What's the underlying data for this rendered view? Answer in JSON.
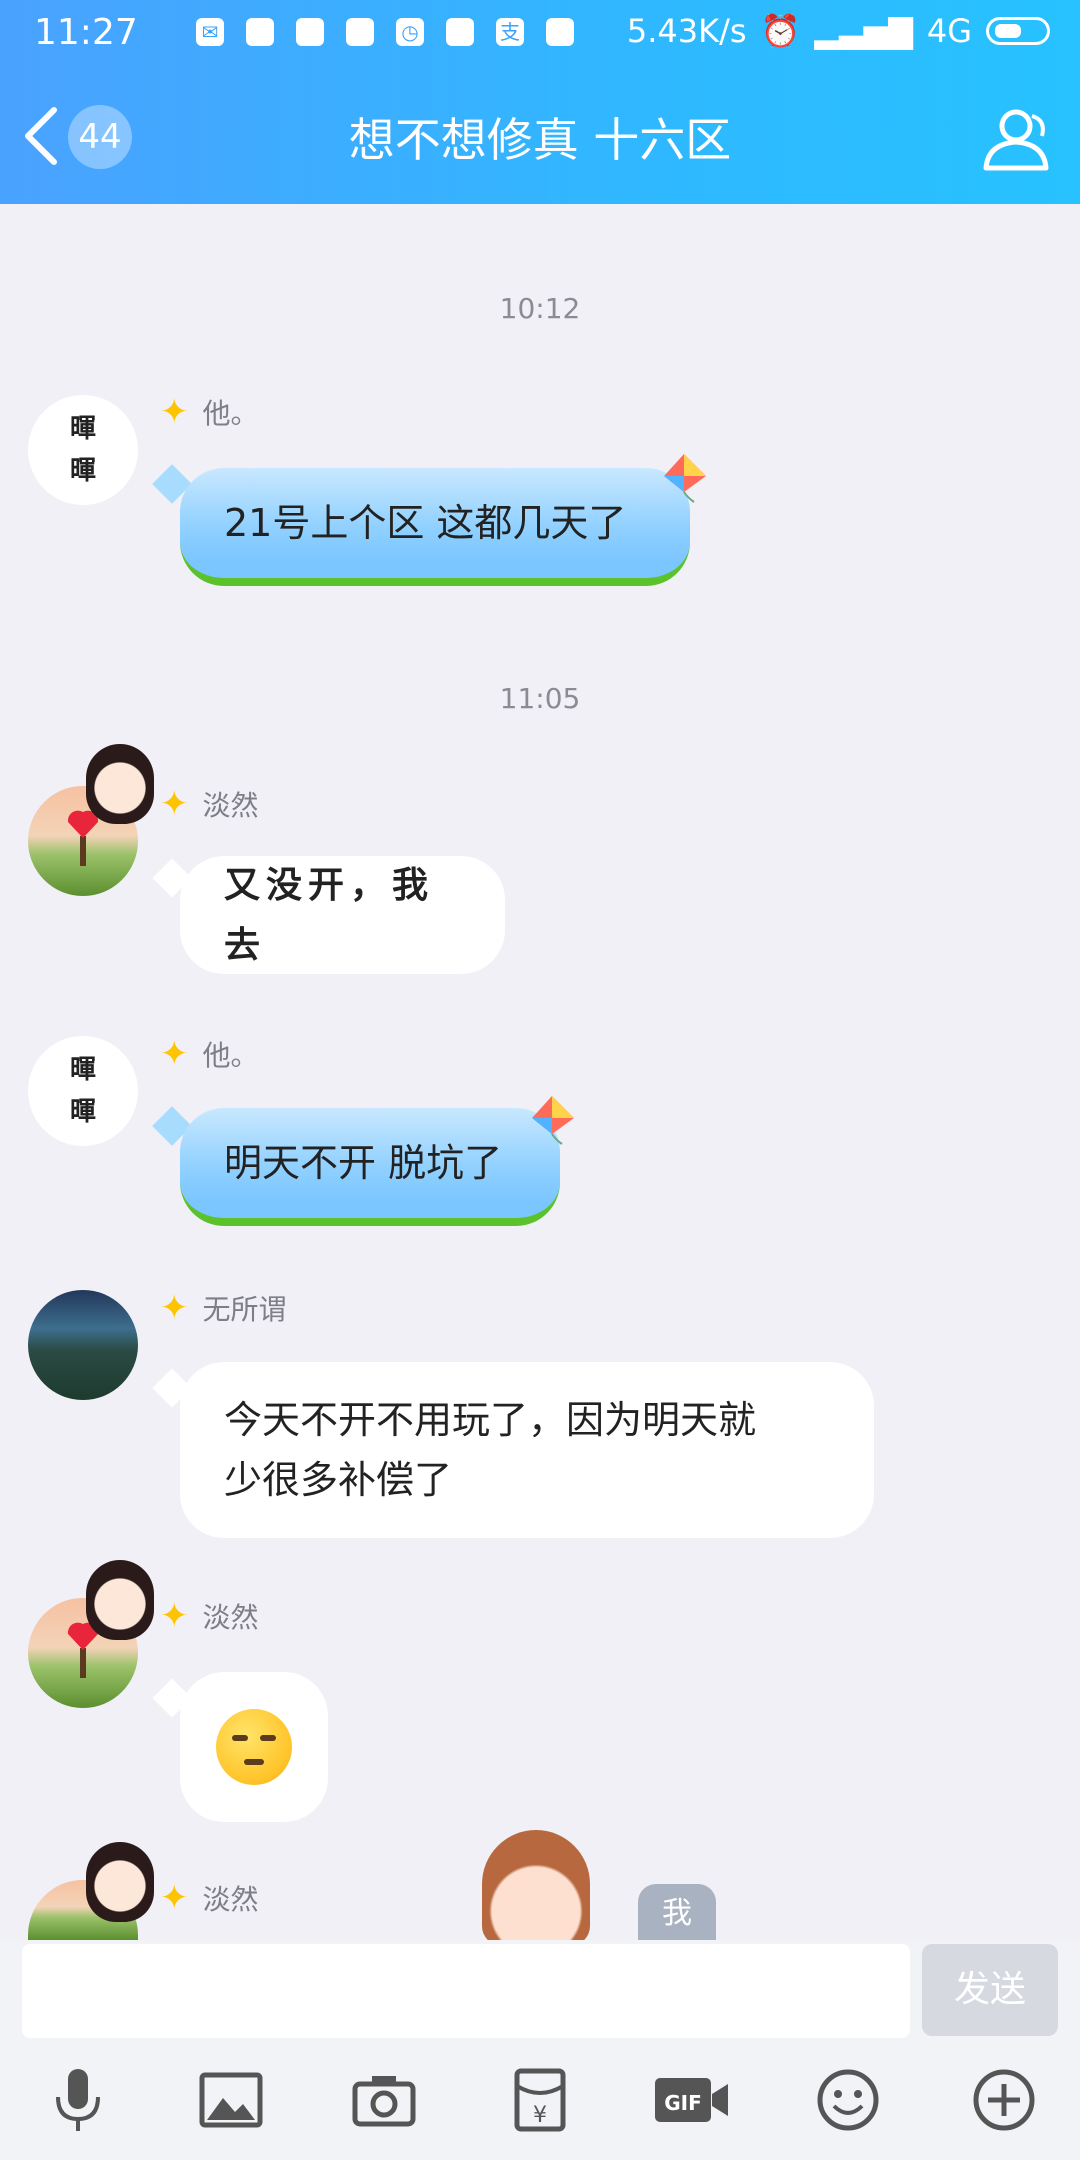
{
  "status_bar": {
    "time": "11:27",
    "network_speed": "5.43K/s",
    "network_type": "4G"
  },
  "header": {
    "back_count": "44",
    "title": "想不想修真 十六区"
  },
  "messages": {
    "ts1": "10:12",
    "m1": {
      "sender": "他。",
      "avatar_text": [
        "暉",
        "暉"
      ],
      "text": "21号上个区 这都几天了"
    },
    "ts2": "11:05",
    "m2": {
      "sender": "淡然",
      "text": "又没开，我去"
    },
    "m3": {
      "sender": "他。",
      "avatar_text": [
        "暉",
        "暉"
      ],
      "text": "明天不开 脱坑了"
    },
    "m4": {
      "sender": "无所谓",
      "text_line1": "今天不开不用玩了，因为明天就",
      "text_line2": "少很多补偿了"
    },
    "m5": {
      "sender": "淡然",
      "emoji": "sleepy-face"
    },
    "m6": {
      "sender": "淡然"
    }
  },
  "me_label": "我",
  "input": {
    "placeholder": "",
    "send_label": "发送"
  },
  "toolbar_icons": [
    "microphone-icon",
    "image-icon",
    "camera-icon",
    "red-packet-icon",
    "gif-icon",
    "emoji-icon",
    "plus-icon"
  ],
  "colors": {
    "header_start": "#4aa2ff",
    "header_end": "#27c2ff",
    "background": "#f0f0f6",
    "send_disabled": "#d7d9e0"
  }
}
